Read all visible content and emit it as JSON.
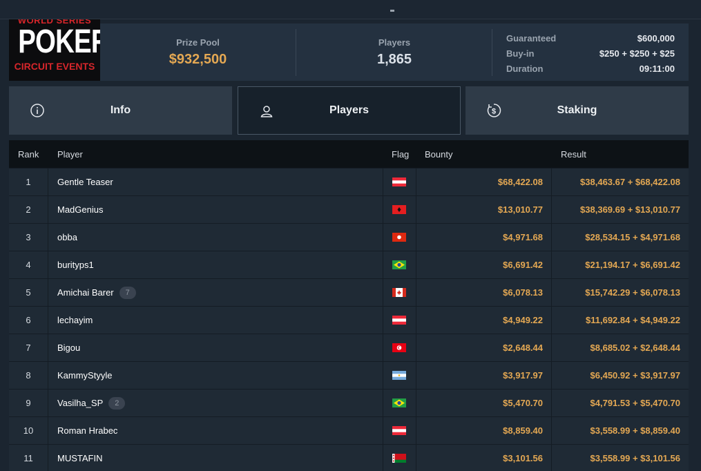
{
  "logo": {
    "top_text": "WORLD SERIES",
    "main_text": "POKER",
    "sub_text": "CIRCUIT EVENTS"
  },
  "summary": {
    "prize_pool_label": "Prize Pool",
    "prize_pool_value": "$932,500",
    "players_label": "Players",
    "players_value": "1,865",
    "details": [
      {
        "label": "Guaranteed",
        "value": "$600,000"
      },
      {
        "label": "Buy-in",
        "value": "$250 + $250 + $25"
      },
      {
        "label": "Duration",
        "value": "09:11:00"
      }
    ]
  },
  "tabs": [
    {
      "label": "Info",
      "icon": "info-icon"
    },
    {
      "label": "Players",
      "icon": "user-icon"
    },
    {
      "label": "Staking",
      "icon": "dollar-coin-icon"
    }
  ],
  "table": {
    "headers": {
      "rank": "Rank",
      "player": "Player",
      "flag": "Flag",
      "bounty": "Bounty",
      "result": "Result"
    },
    "rows": [
      {
        "rank": "1",
        "player": "Gentle Teaser",
        "badge": "",
        "flag": "austria",
        "bounty": "$68,422.08",
        "result": "$38,463.67 + $68,422.08"
      },
      {
        "rank": "2",
        "player": "MadGenius",
        "badge": "",
        "flag": "albania",
        "bounty": "$13,010.77",
        "result": "$38,369.69 + $13,010.77"
      },
      {
        "rank": "3",
        "player": "obba",
        "badge": "",
        "flag": "hong-kong",
        "bounty": "$4,971.68",
        "result": "$28,534.15 + $4,971.68"
      },
      {
        "rank": "4",
        "player": "burityps1",
        "badge": "",
        "flag": "brazil",
        "bounty": "$6,691.42",
        "result": "$21,194.17 + $6,691.42"
      },
      {
        "rank": "5",
        "player": "Amichai Barer",
        "badge": "7",
        "flag": "canada",
        "bounty": "$6,078.13",
        "result": "$15,742.29 + $6,078.13"
      },
      {
        "rank": "6",
        "player": "lechayim",
        "badge": "",
        "flag": "austria",
        "bounty": "$4,949.22",
        "result": "$11,692.84 + $4,949.22"
      },
      {
        "rank": "7",
        "player": "Bigou",
        "badge": "",
        "flag": "tunisia",
        "bounty": "$2,648.44",
        "result": "$8,685.02 + $2,648.44"
      },
      {
        "rank": "8",
        "player": "KammyStyyle",
        "badge": "",
        "flag": "argentina",
        "bounty": "$3,917.97",
        "result": "$6,450.92 + $3,917.97"
      },
      {
        "rank": "9",
        "player": "Vasilha_SP",
        "badge": "2",
        "flag": "brazil",
        "bounty": "$5,470.70",
        "result": "$4,791.53 + $5,470.70"
      },
      {
        "rank": "10",
        "player": "Roman Hrabec",
        "badge": "",
        "flag": "austria",
        "bounty": "$8,859.40",
        "result": "$3,558.99 + $8,859.40"
      },
      {
        "rank": "11",
        "player": "MUSTAFIN",
        "badge": "",
        "flag": "belarus",
        "bounty": "$3,101.56",
        "result": "$3,558.99 + $3,101.56"
      }
    ]
  },
  "colors": {
    "accent": "#e4a853",
    "background": "#1b2530",
    "row": "#1f2a35",
    "header": "#0d1216"
  }
}
